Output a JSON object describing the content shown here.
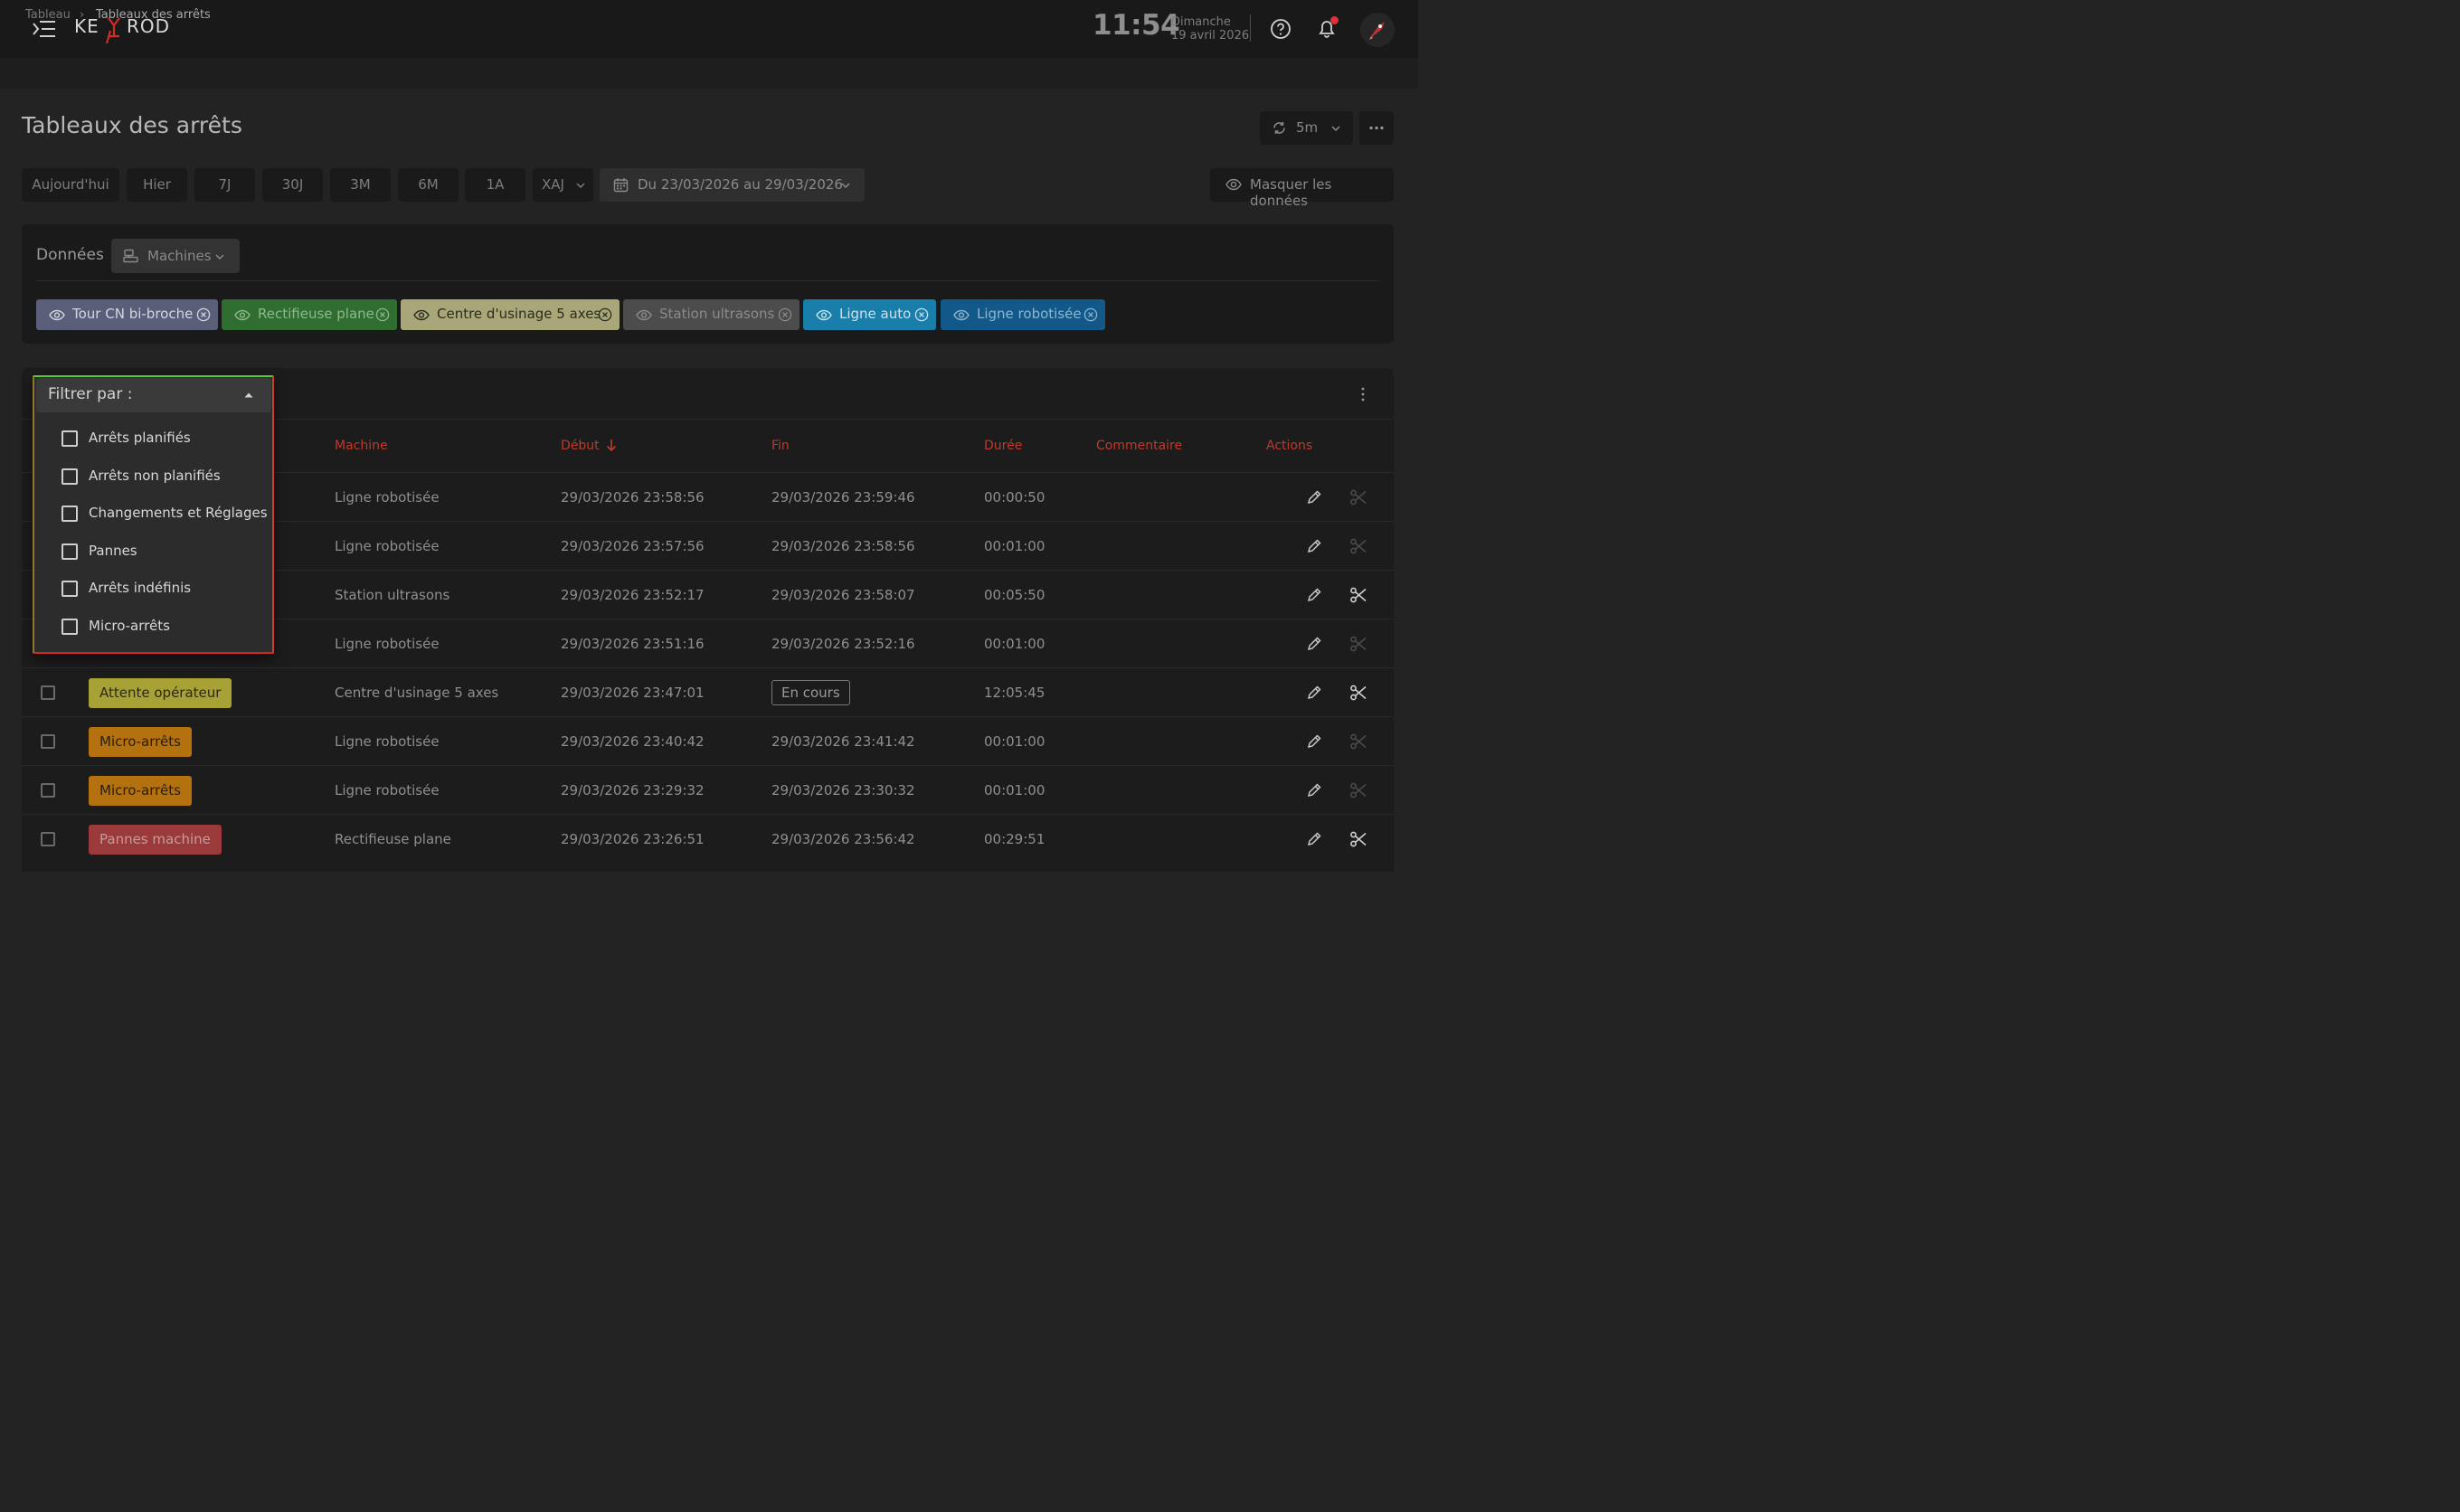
{
  "header": {
    "logo_text": "KEYPROD",
    "time": "11:54",
    "day": "Dimanche",
    "date": "19 avril 2026"
  },
  "breadcrumb": {
    "root": "Tableau",
    "separator": "›",
    "current": "Tableaux des arrêts"
  },
  "page": {
    "title": "Tableaux des arrêts"
  },
  "toolbar": {
    "refresh_interval": "5m",
    "more_label": "···"
  },
  "time_range": {
    "buttons": [
      "Aujourd'hui",
      "Hier",
      "7J",
      "30J",
      "3M",
      "6M",
      "1A"
    ],
    "custom_label": "XAJ",
    "date_range": "Du 23/03/2026 au 29/03/2026",
    "hide_data_label": "Masquer les données"
  },
  "data_panel": {
    "label": "Données",
    "select_value": "Machines",
    "chips": [
      {
        "label": "Tour CN bi-broche",
        "bg": "#5b5e78",
        "fg": "#d6d6e2"
      },
      {
        "label": "Rectifieuse plane",
        "bg": "#2f6d31",
        "fg": "#8fb88d"
      },
      {
        "label": "Centre d'usinage 5 axes",
        "bg": "#a9a779",
        "fg": "#2b2b20"
      },
      {
        "label": "Station ultrasons",
        "bg": "#4c4c4c",
        "fg": "#8b8b8b"
      },
      {
        "label": "Ligne auto",
        "bg": "#1a7eaa",
        "fg": "#c8e2ee"
      },
      {
        "label": "Ligne robotisée",
        "bg": "#12598a",
        "fg": "#8fb6d0"
      }
    ]
  },
  "table": {
    "columns": {
      "machine": "Machine",
      "start": "Début",
      "end": "Fin",
      "duration": "Durée",
      "comment": "Commentaire",
      "actions": "Actions"
    },
    "rows": [
      {
        "type": "",
        "machine": "Ligne robotisée",
        "start": "29/03/2026 23:58:56",
        "end": "29/03/2026 23:59:46",
        "duration": "00:00:50",
        "comment": "",
        "cut_active": false
      },
      {
        "type": "",
        "machine": "Ligne robotisée",
        "start": "29/03/2026 23:57:56",
        "end": "29/03/2026 23:58:56",
        "duration": "00:01:00",
        "comment": "",
        "cut_active": false
      },
      {
        "type": "",
        "machine": "Station ultrasons",
        "start": "29/03/2026 23:52:17",
        "end": "29/03/2026 23:58:07",
        "duration": "00:05:50",
        "comment": "",
        "cut_active": true
      },
      {
        "type": "",
        "machine": "Ligne robotisée",
        "start": "29/03/2026 23:51:16",
        "end": "29/03/2026 23:52:16",
        "duration": "00:01:00",
        "comment": "",
        "cut_active": false
      },
      {
        "type": "Attente opérateur",
        "badge_bg": "#a8a236",
        "badge_fg": "#2a2a14",
        "machine": "Centre d'usinage 5 axes",
        "start": "29/03/2026 23:47:01",
        "end": "En cours",
        "duration": "12:05:45",
        "comment": "",
        "cut_active": true
      },
      {
        "type": "Micro-arrêts",
        "badge_bg": "#b3720f",
        "badge_fg": "#2d1d05",
        "machine": "Ligne robotisée",
        "start": "29/03/2026 23:40:42",
        "end": "29/03/2026 23:41:42",
        "duration": "00:01:00",
        "comment": "",
        "cut_active": false
      },
      {
        "type": "Micro-arrêts",
        "badge_bg": "#b3720f",
        "badge_fg": "#2d1d05",
        "machine": "Ligne robotisée",
        "start": "29/03/2026 23:29:32",
        "end": "29/03/2026 23:30:32",
        "duration": "00:01:00",
        "comment": "",
        "cut_active": false
      },
      {
        "type": "Pannes machine",
        "badge_bg": "#9a3a3a",
        "badge_fg": "#c99a9a",
        "machine": "Rectifieuse plane",
        "start": "29/03/2026 23:26:51",
        "end": "29/03/2026 23:56:42",
        "duration": "00:29:51",
        "comment": "",
        "cut_active": true
      }
    ]
  },
  "filter": {
    "title": "Filtrer par :",
    "options": [
      "Arrêts planifiés",
      "Arrêts non planifiés",
      "Changements et Réglages",
      "Pannes",
      "Arrêts indéfinis",
      "Micro-arrêts"
    ]
  },
  "colors": {
    "accent_header": "#c0392b",
    "notification_dot": "#e0303a"
  }
}
